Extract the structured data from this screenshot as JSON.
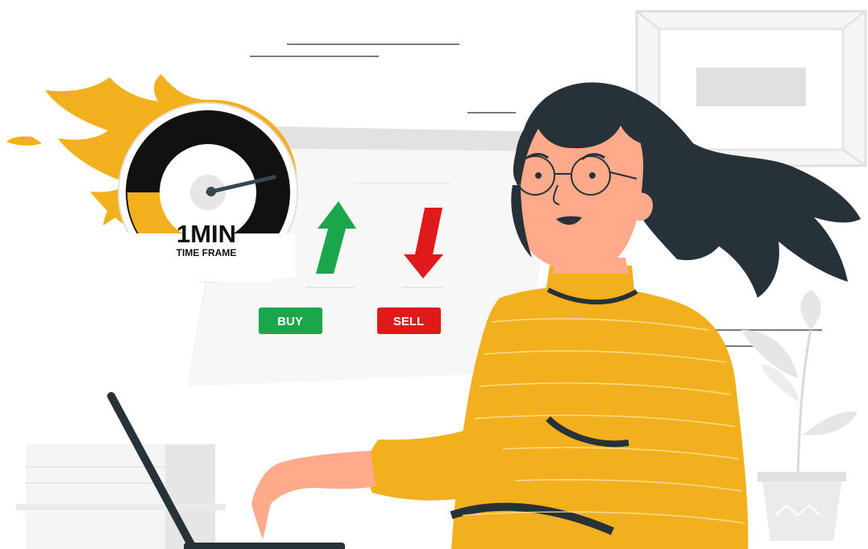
{
  "gauge": {
    "value_label": "1MIN",
    "caption": "TIME FRAME"
  },
  "buttons": {
    "buy_label": "BUY",
    "sell_label": "SELL"
  },
  "colors": {
    "buy": "#1aa74a",
    "sell": "#e0191b",
    "flame": "#f2b01e",
    "sweater": "#f2b01e",
    "hair": "#263238",
    "skin": "#ffaa8a"
  }
}
